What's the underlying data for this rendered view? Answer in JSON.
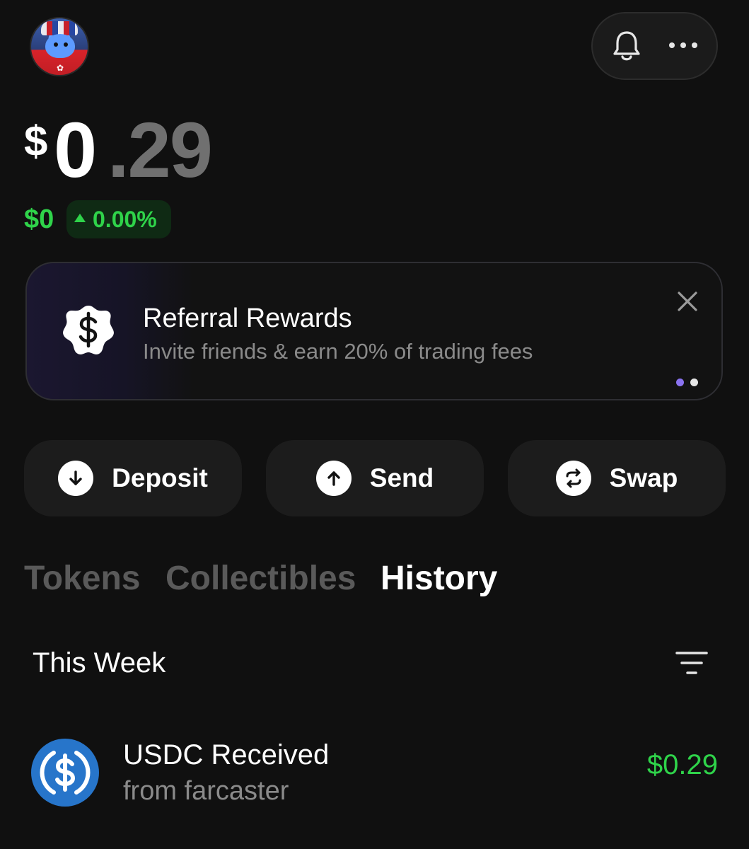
{
  "header": {
    "avatar_icon": "user-avatar-icon",
    "notifications_icon": "bell-icon",
    "more_icon": "more-dots-icon"
  },
  "balance": {
    "currency_symbol": "$",
    "integer": "0",
    "decimal": ".29",
    "change_amount": "$0",
    "change_percent": "0.00%",
    "change_direction": "up",
    "change_color": "#2fd34a"
  },
  "promo": {
    "title": "Referral Rewards",
    "subtitle": "Invite friends & earn 20% of trading fees",
    "icon": "dollar-badge-icon",
    "close_icon": "close-icon",
    "pages": 2,
    "active_page": 1
  },
  "actions": [
    {
      "label": "Deposit",
      "icon": "arrow-down-icon"
    },
    {
      "label": "Send",
      "icon": "arrow-up-icon"
    },
    {
      "label": "Swap",
      "icon": "swap-icon"
    }
  ],
  "tabs": [
    {
      "label": "Tokens",
      "active": false
    },
    {
      "label": "Collectibles",
      "active": false
    },
    {
      "label": "History",
      "active": true
    }
  ],
  "history": {
    "section_title": "This Week",
    "filter_icon": "filter-icon",
    "items": [
      {
        "title": "USDC Received",
        "subtitle": "from farcaster",
        "amount": "$0.29",
        "icon": "usdc-icon",
        "amount_color": "#2fd34a"
      }
    ]
  }
}
